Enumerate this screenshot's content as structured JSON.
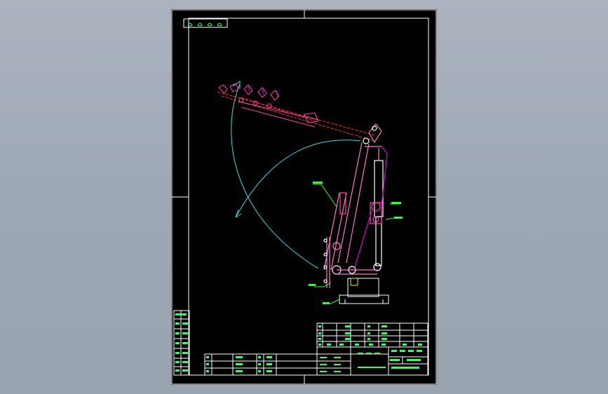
{
  "canvas": {
    "background": "#000000",
    "backdrop": "#a2acb8"
  },
  "colors": {
    "frame": "#ffffff",
    "mechanism": "#ff44aa",
    "arc": "#33e0e0",
    "labels": "#33ff33",
    "titleblock": "#33ff66",
    "magenta_line": "#e000e0",
    "red_line": "#ff3333",
    "yellow": "#ffee00"
  },
  "drawing": {
    "description_icons": [
      "crane-arm-icon",
      "swing-arc-icon",
      "hydraulic-cylinder-icon",
      "base-plate-icon"
    ],
    "corner_tag_glyphs": "ꝛꝛꝛꝛ"
  }
}
